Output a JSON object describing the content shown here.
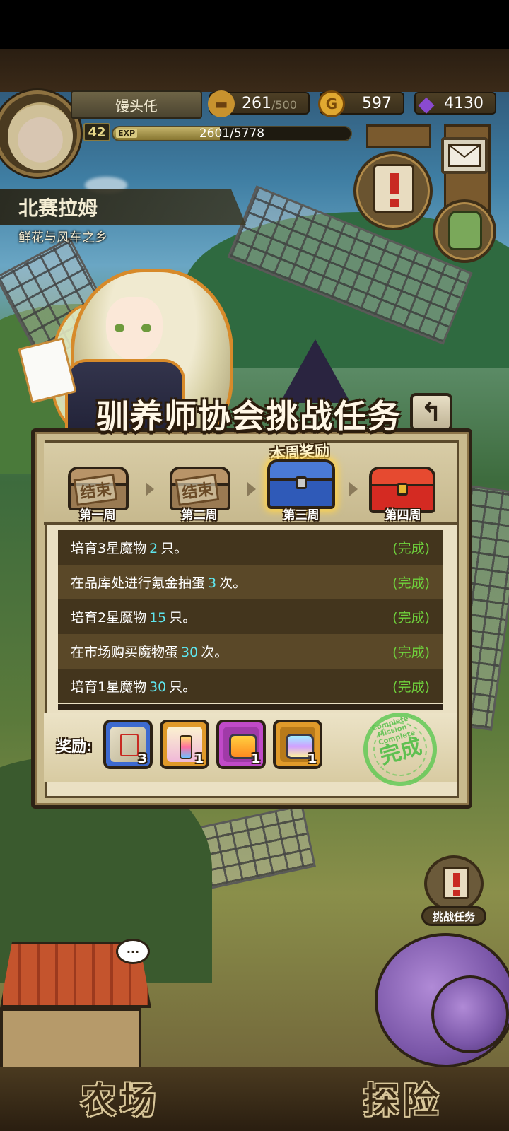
{
  "hud": {
    "player_name": "馒头仛",
    "level": "42",
    "exp_tag": "EXP",
    "exp_text": "2601/5778",
    "exp_fraction": 0.45,
    "stamina": {
      "value": "261",
      "max": "/500",
      "icon": "bread-icon"
    },
    "gold": {
      "value": "597",
      "icon": "gold-coin-icon"
    },
    "gems": {
      "value": "4130",
      "icon": "purple-gem-icon"
    }
  },
  "location": {
    "name": "北赛拉姆",
    "subtitle": "鲜花与风车之乡"
  },
  "dialog": {
    "title": "驯养师协会挑战任务",
    "this_week_tag": "本周奖励",
    "weeks": [
      {
        "label": "第一周",
        "stamp": "结束",
        "state": "finished",
        "color": "#8a6a42"
      },
      {
        "label": "第二周",
        "stamp": "结束",
        "state": "finished",
        "color": "#8a6a42"
      },
      {
        "label": "第三周",
        "stamp": "",
        "state": "current",
        "color": "#2f5ab8"
      },
      {
        "label": "第四周",
        "stamp": "",
        "state": "locked",
        "color": "#d42a22"
      }
    ],
    "tasks": [
      {
        "before": "培育3星魔物",
        "num": "2",
        "after": "只。",
        "status": "(完成)"
      },
      {
        "before": "在品库处进行氪金抽蛋",
        "num": "3",
        "after": "次。",
        "status": "(完成)"
      },
      {
        "before": "培育2星魔物",
        "num": "15",
        "after": "只。",
        "status": "(完成)"
      },
      {
        "before": "在市场购买魔物蛋",
        "num": "30",
        "after": "次。",
        "status": "(完成)"
      },
      {
        "before": "培育1星魔物",
        "num": "30",
        "after": "只。",
        "status": "(完成)"
      }
    ],
    "rewards_label": "奖励:",
    "rewards": [
      {
        "icon": "scroll-icon",
        "count": "3",
        "frame": "#3d6ad0"
      },
      {
        "icon": "winged-potion-icon",
        "count": "1",
        "frame": "#e09a2a"
      },
      {
        "icon": "orange-egg-capsule-icon",
        "count": "1",
        "frame": "#c04ac8"
      },
      {
        "icon": "rainbow-egg-capsule-icon",
        "count": "1",
        "frame": "#e09a2a"
      }
    ],
    "complete_stamp": "完成",
    "complete_stamp_ring": "Complete · Mission · Complete"
  },
  "side": {
    "challenge_label": "挑战任务",
    "bubble_text": "···"
  },
  "nav": {
    "farm": "农场",
    "adventure": "探险"
  }
}
